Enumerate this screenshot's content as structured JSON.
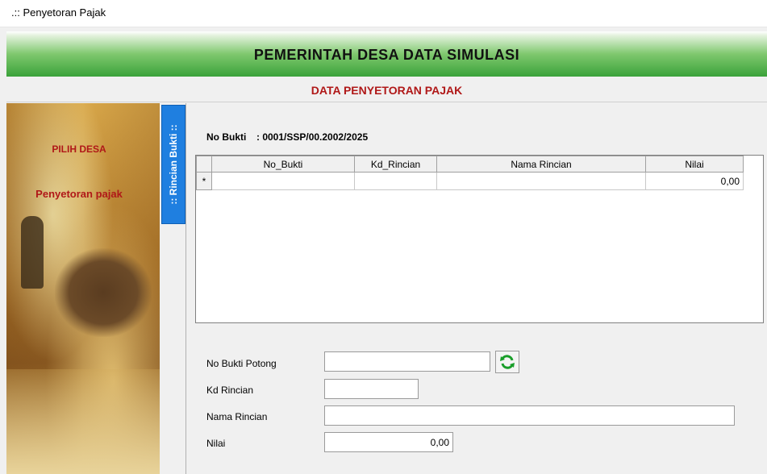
{
  "window": {
    "title": ".:: Penyetoran Pajak"
  },
  "header": {
    "title": "PEMERINTAH DESA DATA SIMULASI",
    "subtitle": "DATA PENYETORAN PAJAK"
  },
  "sidebar": {
    "items": [
      "PILIH DESA",
      "Penyetoran pajak"
    ],
    "tab_label": ":: Rincian Bukti ::"
  },
  "main": {
    "no_bukti_label": "No Bukti",
    "no_bukti_value": ": 0001/SSP/00.2002/2025",
    "grid": {
      "columns": [
        "No_Bukti",
        "Kd_Rincian",
        "Nama Rincian",
        "Nilai"
      ],
      "new_row_marker": "*",
      "rows": [
        [
          "",
          "",
          "",
          "0,00"
        ]
      ]
    },
    "form": {
      "no_bukti_potong_label": "No Bukti Potong",
      "no_bukti_potong_value": "",
      "kd_rincian_label": "Kd Rincian",
      "kd_rincian_value": "",
      "nama_rincian_label": "Nama Rincian",
      "nama_rincian_value": "",
      "nilai_label": "Nilai",
      "nilai_value": "0,00"
    }
  },
  "icons": {
    "refresh": "refresh-icon"
  },
  "colors": {
    "header_green": "#3aa23a",
    "title_red": "#b01818",
    "tab_blue": "#1f7fe0",
    "refresh_green": "#1a9e2a"
  }
}
